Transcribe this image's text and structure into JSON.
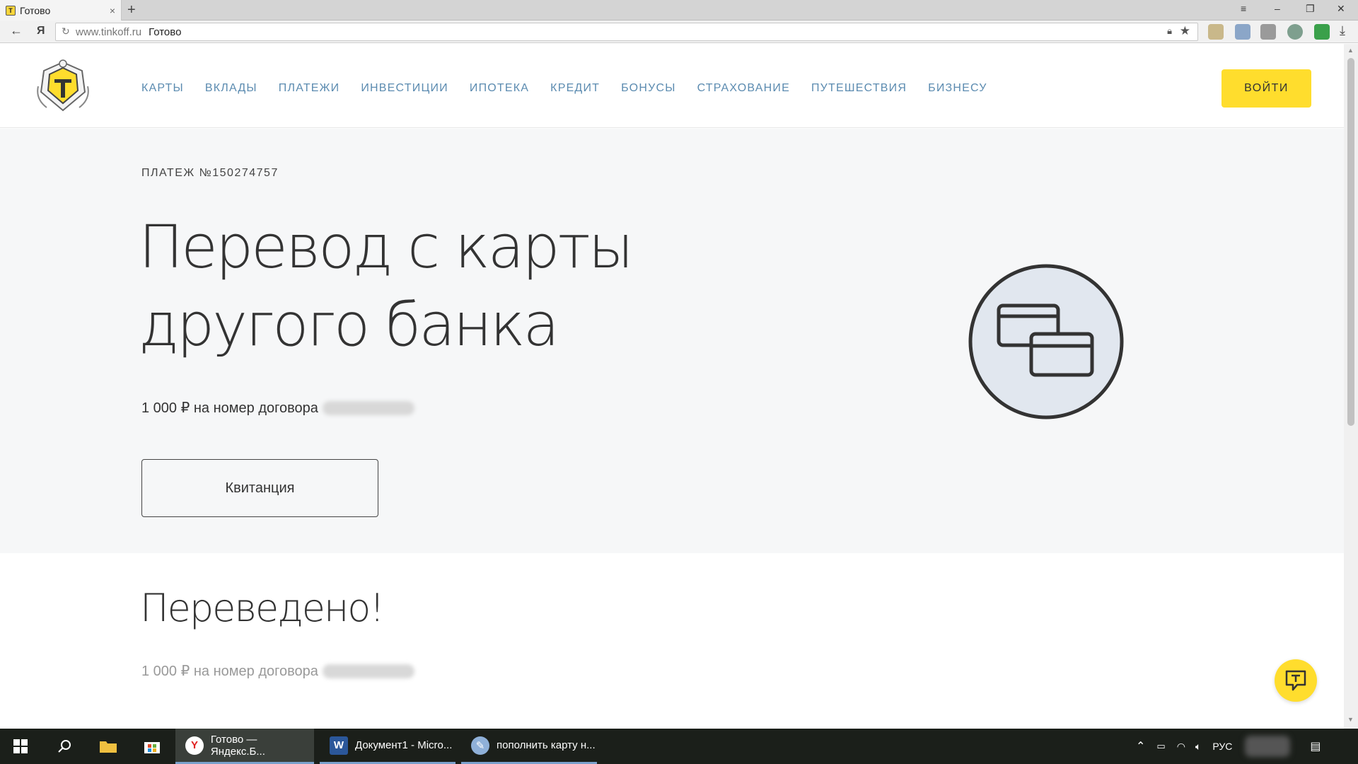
{
  "browser": {
    "tab_title": "Готово",
    "tab_favicon_letter": "T",
    "new_tab": "+",
    "url_domain": "www.tinkoff.ru",
    "url_title": "Готово"
  },
  "header": {
    "nav": [
      "КАРТЫ",
      "ВКЛАДЫ",
      "ПЛАТЕЖИ",
      "ИНВЕСТИЦИИ",
      "ИПОТЕКА",
      "КРЕДИТ",
      "БОНУСЫ",
      "СТРАХОВАНИЕ",
      "ПУТЕШЕСТВИЯ",
      "БИЗНЕСУ"
    ],
    "login_label": "ВОЙТИ"
  },
  "hero": {
    "payment_number": "ПЛАТЕЖ №150274757",
    "title": "Перевод с карты другого банка",
    "subtitle": "1 000 ₽ на номер договора",
    "receipt_label": "Квитанция"
  },
  "result": {
    "title": "Переведено!",
    "subtitle": "1 000 ₽ на номер договора"
  },
  "taskbar": {
    "apps": [
      {
        "label": "Готово — Яндекс.Б...",
        "icon": "yandex-browser-icon"
      },
      {
        "label": "Документ1 - Micro...",
        "icon": "word-icon"
      },
      {
        "label": "пополнить карту н...",
        "icon": "paint-icon"
      }
    ],
    "language": "РУС"
  },
  "colors": {
    "accent_yellow": "#ffdd2d",
    "nav_blue": "#5b8bb0",
    "hero_bg": "#f6f7f8"
  }
}
